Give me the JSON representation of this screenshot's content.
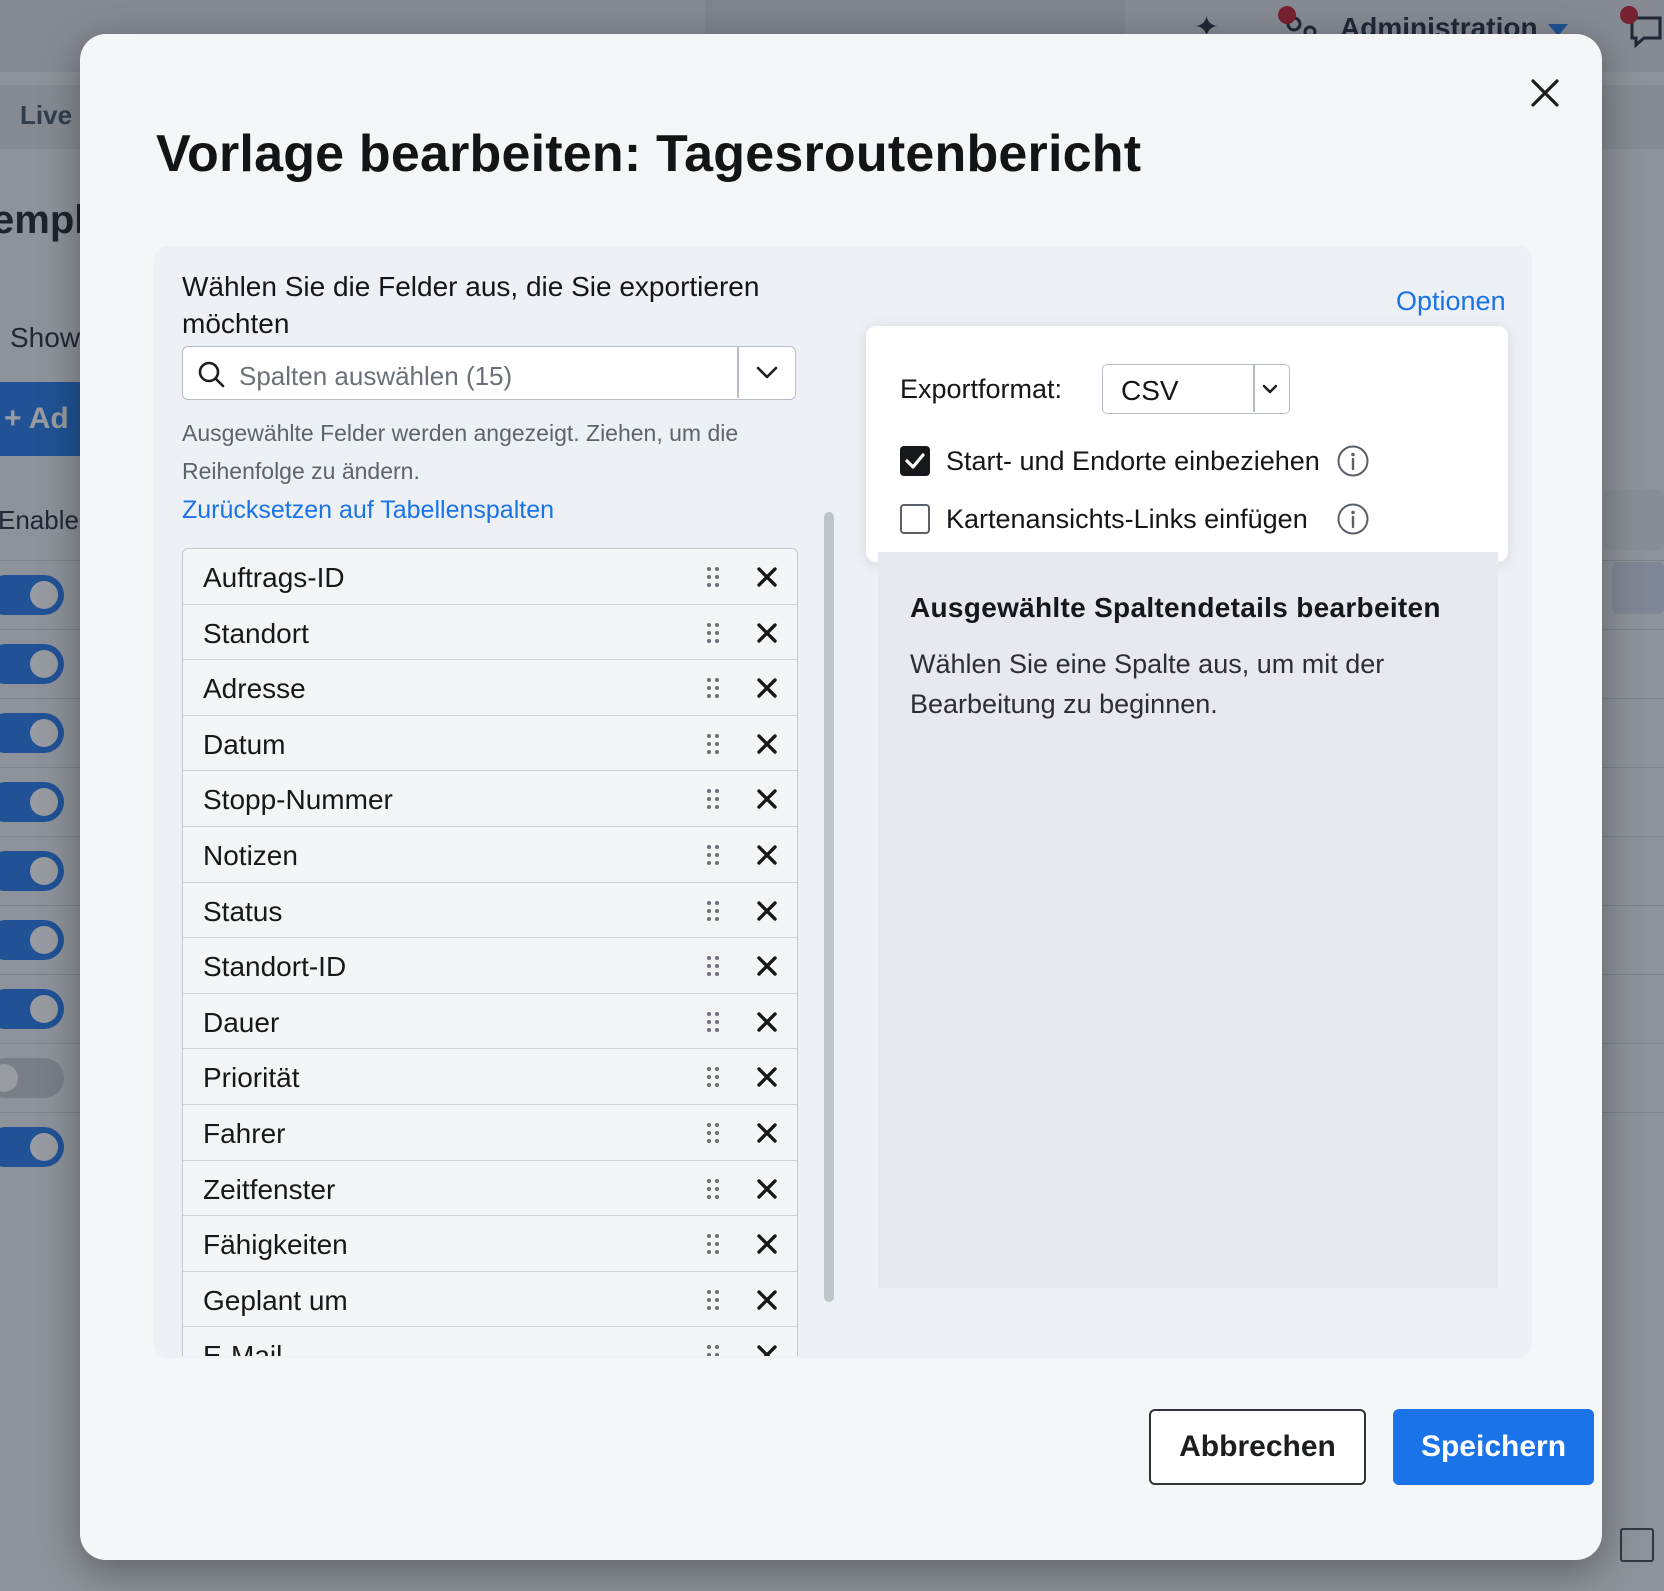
{
  "background": {
    "admin_label": "Administration",
    "live_tab": "Live",
    "heading_fragment": "empla",
    "show_fragment": "Show",
    "add_fragment": "+ Ad",
    "enable_fragment": "Enable",
    "toggles": [
      true,
      true,
      true,
      true,
      true,
      true,
      true,
      false,
      true
    ]
  },
  "modal": {
    "title": "Vorlage bearbeiten: Tagesroutenbericht",
    "fields_heading": "Wählen Sie die Felder aus, die Sie exportieren möchten",
    "column_select_placeholder": "Spalten auswählen (15)",
    "hint": "Ausgewählte Felder werden angezeigt. Ziehen, um die Reihenfolge zu ändern.",
    "reset_link": "Zurücksetzen auf Tabellenspalten",
    "fields": [
      "Auftrags-ID",
      "Standort",
      "Adresse",
      "Datum",
      "Stopp-Nummer",
      "Notizen",
      "Status",
      "Standort-ID",
      "Dauer",
      "Priorität",
      "Fahrer",
      "Zeitfenster",
      "Fähigkeiten",
      "Geplant um",
      "E-Mail"
    ],
    "options_link": "Optionen",
    "export_format_label": "Exportformat:",
    "export_format_value": "CSV",
    "checkboxes": [
      {
        "label": "Start- und Endorte einbeziehen",
        "checked": true
      },
      {
        "label": "Kartenansichts-Links einfügen",
        "checked": false
      }
    ],
    "details_title": "Ausgewählte Spaltendetails bearbeiten",
    "details_text": "Wählen Sie eine Spalte aus, um mit der Bearbeitung zu beginnen.",
    "cancel_label": "Abbrechen",
    "save_label": "Speichern"
  },
  "colors": {
    "accent": "#1a73e8",
    "notification": "#c0182b"
  }
}
